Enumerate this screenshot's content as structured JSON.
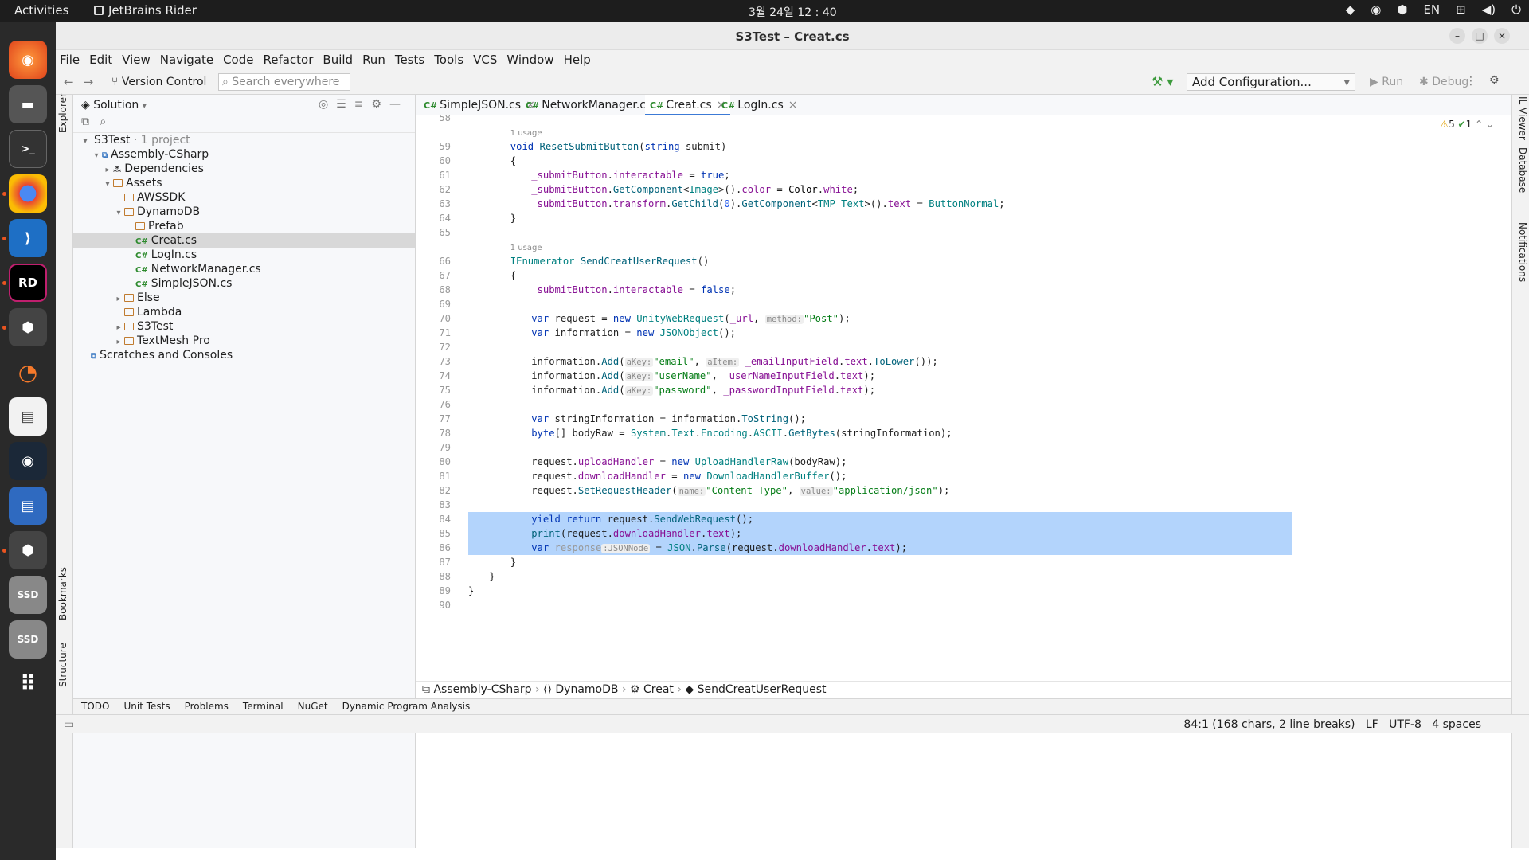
{
  "topbar": {
    "activities": "Activities",
    "app": "JetBrains Rider",
    "clock": "3월 24일  12 : 40",
    "lang": "EN"
  },
  "window": {
    "title": "S3Test – Creat.cs"
  },
  "menu": [
    "File",
    "Edit",
    "View",
    "Navigate",
    "Code",
    "Refactor",
    "Build",
    "Run",
    "Tests",
    "Tools",
    "VCS",
    "Window",
    "Help"
  ],
  "toolbar": {
    "vcs": "Version Control",
    "search_placeholder": "Search everywhere",
    "config": "Add Configuration...",
    "run": "Run",
    "debug": "Debug"
  },
  "left_strip": {
    "explorer": "Explorer",
    "bookmarks": "Bookmarks",
    "structure": "Structure"
  },
  "right_strip": {
    "il_viewer": "IL Viewer",
    "database": "Database",
    "notifications": "Notifications"
  },
  "solution": {
    "title": "Solution",
    "tree": [
      {
        "label": "S3Test",
        "suffix": " · 1 project",
        "depth": 0,
        "icon": "solution",
        "arrow": "down"
      },
      {
        "label": "Assembly-CSharp",
        "depth": 1,
        "icon": "project",
        "arrow": "down"
      },
      {
        "label": "Dependencies",
        "depth": 2,
        "icon": "deps",
        "arrow": "right"
      },
      {
        "label": "Assets",
        "depth": 2,
        "icon": "folder",
        "arrow": "down"
      },
      {
        "label": "AWSSDK",
        "depth": 3,
        "icon": "folder",
        "arrow": ""
      },
      {
        "label": "DynamoDB",
        "depth": 3,
        "icon": "folder",
        "arrow": "down"
      },
      {
        "label": "Prefab",
        "depth": 4,
        "icon": "folder",
        "arrow": ""
      },
      {
        "label": "Creat.cs",
        "depth": 4,
        "icon": "cs",
        "arrow": "",
        "selected": true
      },
      {
        "label": "LogIn.cs",
        "depth": 4,
        "icon": "cs",
        "arrow": ""
      },
      {
        "label": "NetworkManager.cs",
        "depth": 4,
        "icon": "cs",
        "arrow": ""
      },
      {
        "label": "SimpleJSON.cs",
        "depth": 4,
        "icon": "cs",
        "arrow": ""
      },
      {
        "label": "Else",
        "depth": 3,
        "icon": "folder",
        "arrow": "right"
      },
      {
        "label": "Lambda",
        "depth": 3,
        "icon": "folder",
        "arrow": ""
      },
      {
        "label": "S3Test",
        "depth": 3,
        "icon": "folder",
        "arrow": "right"
      },
      {
        "label": "TextMesh Pro",
        "depth": 3,
        "icon": "folder",
        "arrow": "right"
      },
      {
        "label": "Scratches and Consoles",
        "depth": 0,
        "icon": "scratch",
        "arrow": ""
      }
    ]
  },
  "tabs": [
    {
      "label": "SimpleJSON.cs",
      "active": false
    },
    {
      "label": "NetworkManager.cs",
      "active": false
    },
    {
      "label": "Creat.cs",
      "active": true
    },
    {
      "label": "LogIn.cs",
      "active": false
    }
  ],
  "editor": {
    "warnings": "5",
    "ok": "1",
    "lines": [
      {
        "n": "58",
        "html": ""
      },
      {
        "n": "",
        "html": "<span class='usage'>1 usage</span>",
        "indent": 8
      },
      {
        "n": "59",
        "html": "<span class='kw'>void</span> <span class='mth'>ResetSubmitButton</span>(<span class='kw'>string</span> submit)",
        "indent": 8
      },
      {
        "n": "60",
        "html": "{",
        "indent": 8
      },
      {
        "n": "61",
        "html": "<span class='fld'>_submitButton</span>.<span class='fld'>interactable</span> = <span class='kw'>true</span>;",
        "indent": 12
      },
      {
        "n": "62",
        "html": "<span class='fld'>_submitButton</span>.<span class='mth'>GetComponent</span>&lt;<span class='cls'>Image</span>&gt;().<span class='fld'>color</span> = <span class='typ'>Color</span>.<span class='fld'>white</span>;",
        "indent": 12
      },
      {
        "n": "63",
        "html": "<span class='fld'>_submitButton</span>.<span class='fld'>transform</span>.<span class='mth'>GetChild</span>(<span class='num'>0</span>).<span class='mth'>GetComponent</span>&lt;<span class='cls'>TMP_Text</span>&gt;().<span class='fld'>text</span> = <span class='cls'>ButtonNormal</span>;",
        "indent": 12
      },
      {
        "n": "64",
        "html": "}",
        "indent": 8
      },
      {
        "n": "65",
        "html": ""
      },
      {
        "n": "",
        "html": "<span class='usage'>1 usage</span>",
        "indent": 8
      },
      {
        "n": "66",
        "html": "<span class='cls'>IEnumerator</span> <span class='mth'>SendCreatUserRequest</span>()",
        "indent": 8
      },
      {
        "n": "67",
        "html": "{",
        "indent": 8
      },
      {
        "n": "68",
        "html": "<span class='fld'>_submitButton</span>.<span class='fld'>interactable</span> = <span class='kw'>false</span>;",
        "indent": 12
      },
      {
        "n": "69",
        "html": ""
      },
      {
        "n": "70",
        "html": "<span class='kw'>var</span> request = <span class='kw'>new</span> <span class='cls'>UnityWebRequest</span>(<span class='fld'>_url</span>, <span class='hint'>method:</span><span class='str'>\"Post\"</span>);",
        "indent": 12
      },
      {
        "n": "71",
        "html": "<span class='kw'>var</span> information = <span class='kw'>new</span> <span class='cls'>JSONObject</span>();",
        "indent": 12
      },
      {
        "n": "72",
        "html": ""
      },
      {
        "n": "73",
        "html": "information.<span class='mth'>Add</span>(<span class='hint'>aKey:</span><span class='str'>\"email\"</span>, <span class='hint'>aItem:</span> <span class='fld'>_emailInputField</span>.<span class='fld'>text</span>.<span class='mth'>ToLower</span>());",
        "indent": 12
      },
      {
        "n": "74",
        "html": "information.<span class='mth'>Add</span>(<span class='hint'>aKey:</span><span class='str'>\"userName\"</span>, <span class='fld'>_userNameInputField</span>.<span class='fld'>text</span>);",
        "indent": 12
      },
      {
        "n": "75",
        "html": "information.<span class='mth'>Add</span>(<span class='hint'>aKey:</span><span class='str'>\"password\"</span>, <span class='fld'>_passwordInputField</span>.<span class='fld'>text</span>);",
        "indent": 12
      },
      {
        "n": "76",
        "html": ""
      },
      {
        "n": "77",
        "html": "<span class='kw'>var</span> stringInformation = information.<span class='mth'>ToString</span>();",
        "indent": 12
      },
      {
        "n": "78",
        "html": "<span class='kw'>byte</span>[] bodyRaw = <span class='cls'>System</span>.<span class='cls'>Text</span>.<span class='cls'>Encoding</span>.<span class='cls'>ASCII</span>.<span class='mth'>GetBytes</span>(stringInformation);",
        "indent": 12
      },
      {
        "n": "79",
        "html": ""
      },
      {
        "n": "80",
        "html": "request.<span class='fld'>uploadHandler</span> = <span class='kw'>new</span> <span class='cls'>UploadHandlerRaw</span>(bodyRaw);",
        "indent": 12
      },
      {
        "n": "81",
        "html": "request.<span class='fld'>downloadHandler</span> = <span class='kw'>new</span> <span class='cls'>DownloadHandlerBuffer</span>();",
        "indent": 12
      },
      {
        "n": "82",
        "html": "request.<span class='mth'>SetRequestHeader</span>(<span class='hint'>name:</span><span class='str'>\"Content-Type\"</span>, <span class='hint'>value:</span><span class='str'>\"application/json\"</span>);",
        "indent": 12
      },
      {
        "n": "83",
        "html": ""
      },
      {
        "n": "84",
        "html": "<span class='kw'>yield return</span> request.<span class='mth'>SendWebRequest</span>();",
        "indent": 12,
        "hl": true
      },
      {
        "n": "85",
        "html": "<span class='mth'>print</span>(request.<span class='fld'>downloadHandler</span>.<span class='fld'>text</span>);",
        "indent": 12,
        "hl": true
      },
      {
        "n": "86",
        "html": "<span class='kw'>var</span> <span style='color:#999'>response</span><span class='hint'>:JSONNode</span> = <span class='cls'>JSON</span>.<span class='mth'>Parse</span>(request.<span class='fld'>downloadHandler</span>.<span class='fld'>text</span>);",
        "indent": 12,
        "hl": true
      },
      {
        "n": "87",
        "html": "}",
        "indent": 8
      },
      {
        "n": "88",
        "html": "}",
        "indent": 4
      },
      {
        "n": "89",
        "html": "}",
        "indent": 0
      },
      {
        "n": "90",
        "html": ""
      }
    ]
  },
  "breadcrumb": [
    "Assembly-CSharp",
    "DynamoDB",
    "Creat",
    "SendCreatUserRequest"
  ],
  "bottom_tools": [
    "TODO",
    "Unit Tests",
    "Problems",
    "Terminal",
    "NuGet",
    "Dynamic Program Analysis"
  ],
  "status": {
    "pos": "84:1 (168 chars, 2 line breaks)",
    "lf": "LF",
    "enc": "UTF-8",
    "indent": "4 spaces"
  }
}
